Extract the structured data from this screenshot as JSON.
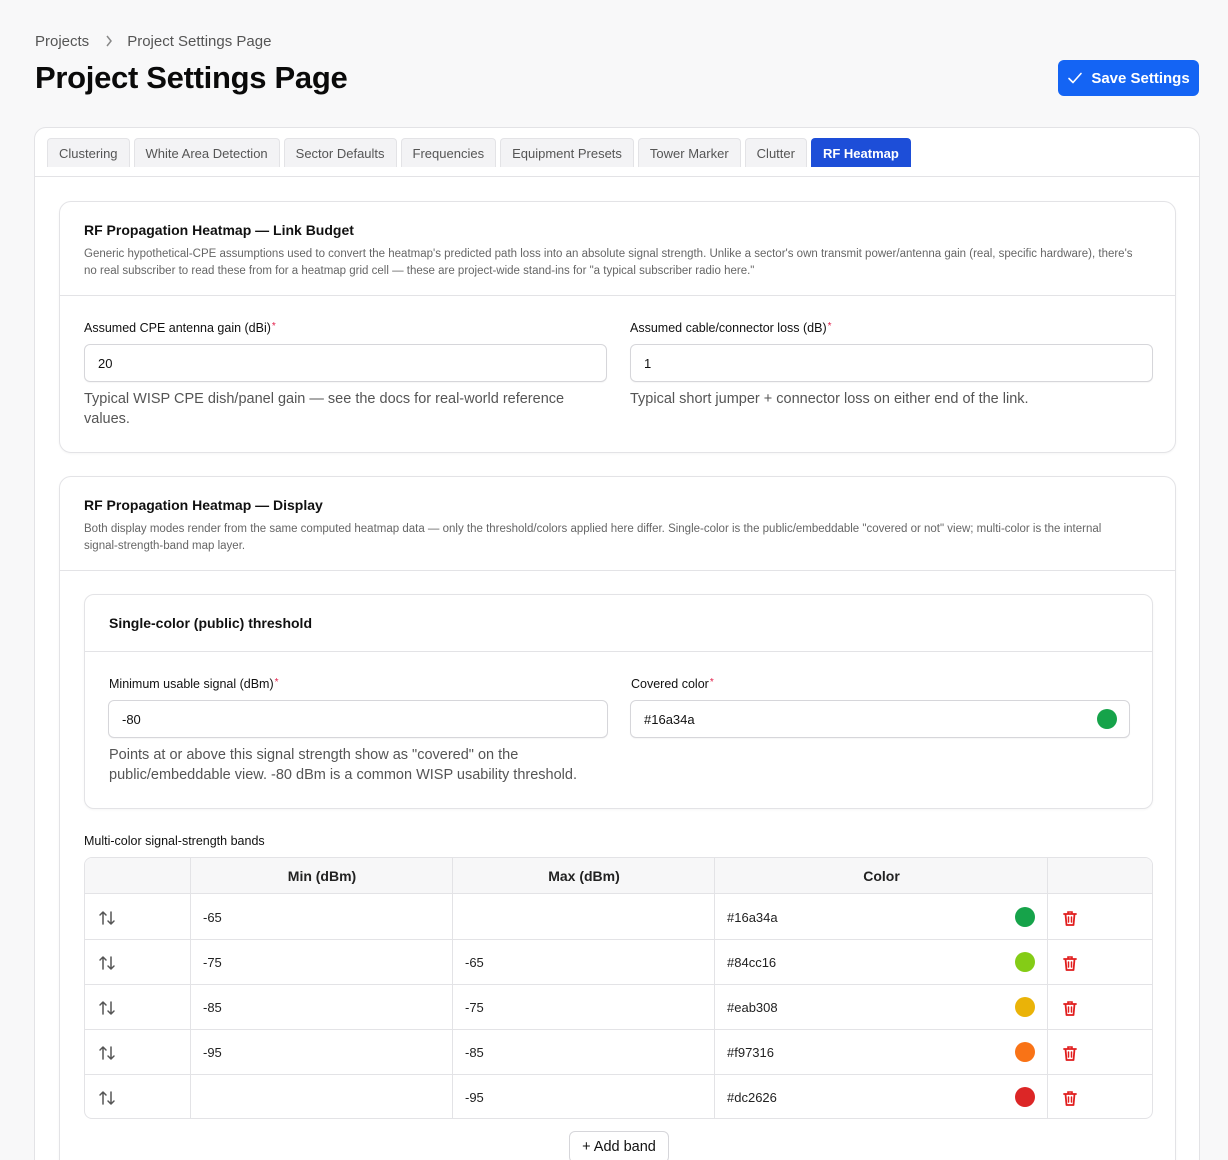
{
  "breadcrumb": {
    "parent": "Projects",
    "current": "Project Settings Page"
  },
  "page": {
    "title": "Project Settings Page",
    "save_label": "Save Settings"
  },
  "tabs": [
    {
      "label": "Clustering"
    },
    {
      "label": "White Area Detection"
    },
    {
      "label": "Sector Defaults"
    },
    {
      "label": "Frequencies"
    },
    {
      "label": "Equipment Presets"
    },
    {
      "label": "Tower Marker"
    },
    {
      "label": "Clutter"
    },
    {
      "label": "RF Heatmap",
      "active": true
    }
  ],
  "link_budget": {
    "title": "RF Propagation Heatmap — Link Budget",
    "description": "Generic hypothetical-CPE assumptions used to convert the heatmap's predicted path loss into an absolute signal strength. Unlike a sector's own transmit power/antenna gain (real, specific hardware), there's no real subscriber to read these from for a heatmap grid cell — these are project-wide stand-ins for \"a typical subscriber radio here.\"",
    "cpe_gain": {
      "label": "Assumed CPE antenna gain (dBi)",
      "value": "20",
      "help": "Typical WISP CPE dish/panel gain — see the docs for real-world reference values."
    },
    "cable_loss": {
      "label": "Assumed cable/connector loss (dB)",
      "value": "1",
      "help": "Typical short jumper + connector loss on either end of the link."
    }
  },
  "display": {
    "title": "RF Propagation Heatmap — Display",
    "description": "Both display modes render from the same computed heatmap data — only the threshold/colors applied here differ. Single-color is the public/embeddable \"covered or not\" view; multi-color is the internal signal-strength-band map layer.",
    "single_color": {
      "title": "Single-color (public) threshold",
      "min_signal": {
        "label": "Minimum usable signal (dBm)",
        "value": "-80",
        "help": "Points at or above this signal strength show as \"covered\" on the public/embeddable view. -80 dBm is a common WISP usability threshold."
      },
      "covered_color": {
        "label": "Covered color",
        "value": "#16a34a"
      }
    },
    "bands": {
      "label": "Multi-color signal-strength bands",
      "headers": {
        "min": "Min (dBm)",
        "max": "Max (dBm)",
        "color": "Color"
      },
      "rows": [
        {
          "min": "-65",
          "max": "",
          "color": "#16a34a"
        },
        {
          "min": "-75",
          "max": "-65",
          "color": "#84cc16"
        },
        {
          "min": "-85",
          "max": "-75",
          "color": "#eab308"
        },
        {
          "min": "-95",
          "max": "-85",
          "color": "#f97316"
        },
        {
          "min": "",
          "max": "-95",
          "color": "#dc2626"
        }
      ],
      "add_label": "+ Add band"
    }
  },
  "icons": {
    "save": "check-icon",
    "reorder": "reorder-arrows-icon",
    "delete": "trash-icon"
  },
  "colors": {
    "primary": "#1464f4",
    "tab_active": "#1d4ed8",
    "danger": "#e11d1d"
  }
}
